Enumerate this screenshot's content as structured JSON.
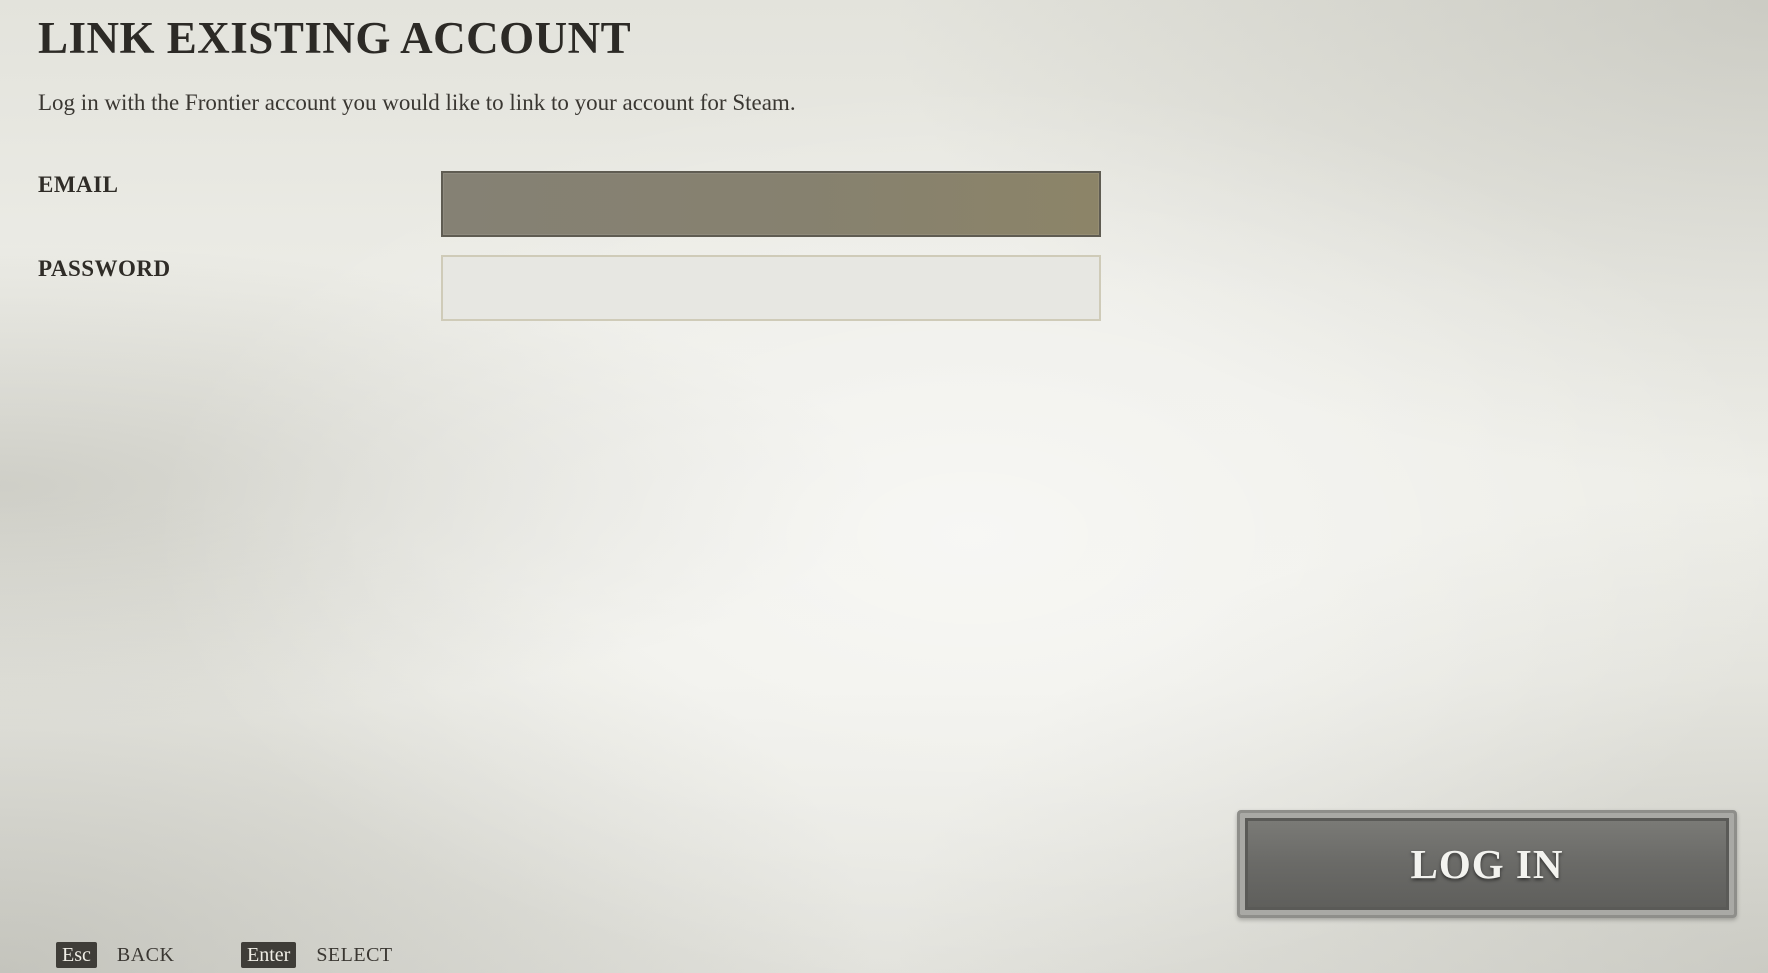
{
  "page": {
    "title": "LINK EXISTING ACCOUNT",
    "subtitle": "Log in with the Frontier account you would like to link to your account for Steam."
  },
  "form": {
    "email": {
      "label": "EMAIL",
      "value": "",
      "placeholder": ""
    },
    "password": {
      "label": "PASSWORD",
      "value": "",
      "placeholder": ""
    }
  },
  "login_button": {
    "label": "LOG IN"
  },
  "hints": [
    {
      "key": "Esc",
      "action": "BACK"
    },
    {
      "key": "Enter",
      "action": "SELECT"
    }
  ],
  "colors": {
    "active_field": "#86816f",
    "inactive_field": "#e7e7e2",
    "button": "#6a6a67",
    "text": "#2f2c27",
    "key_cap": "#3f3d38"
  }
}
